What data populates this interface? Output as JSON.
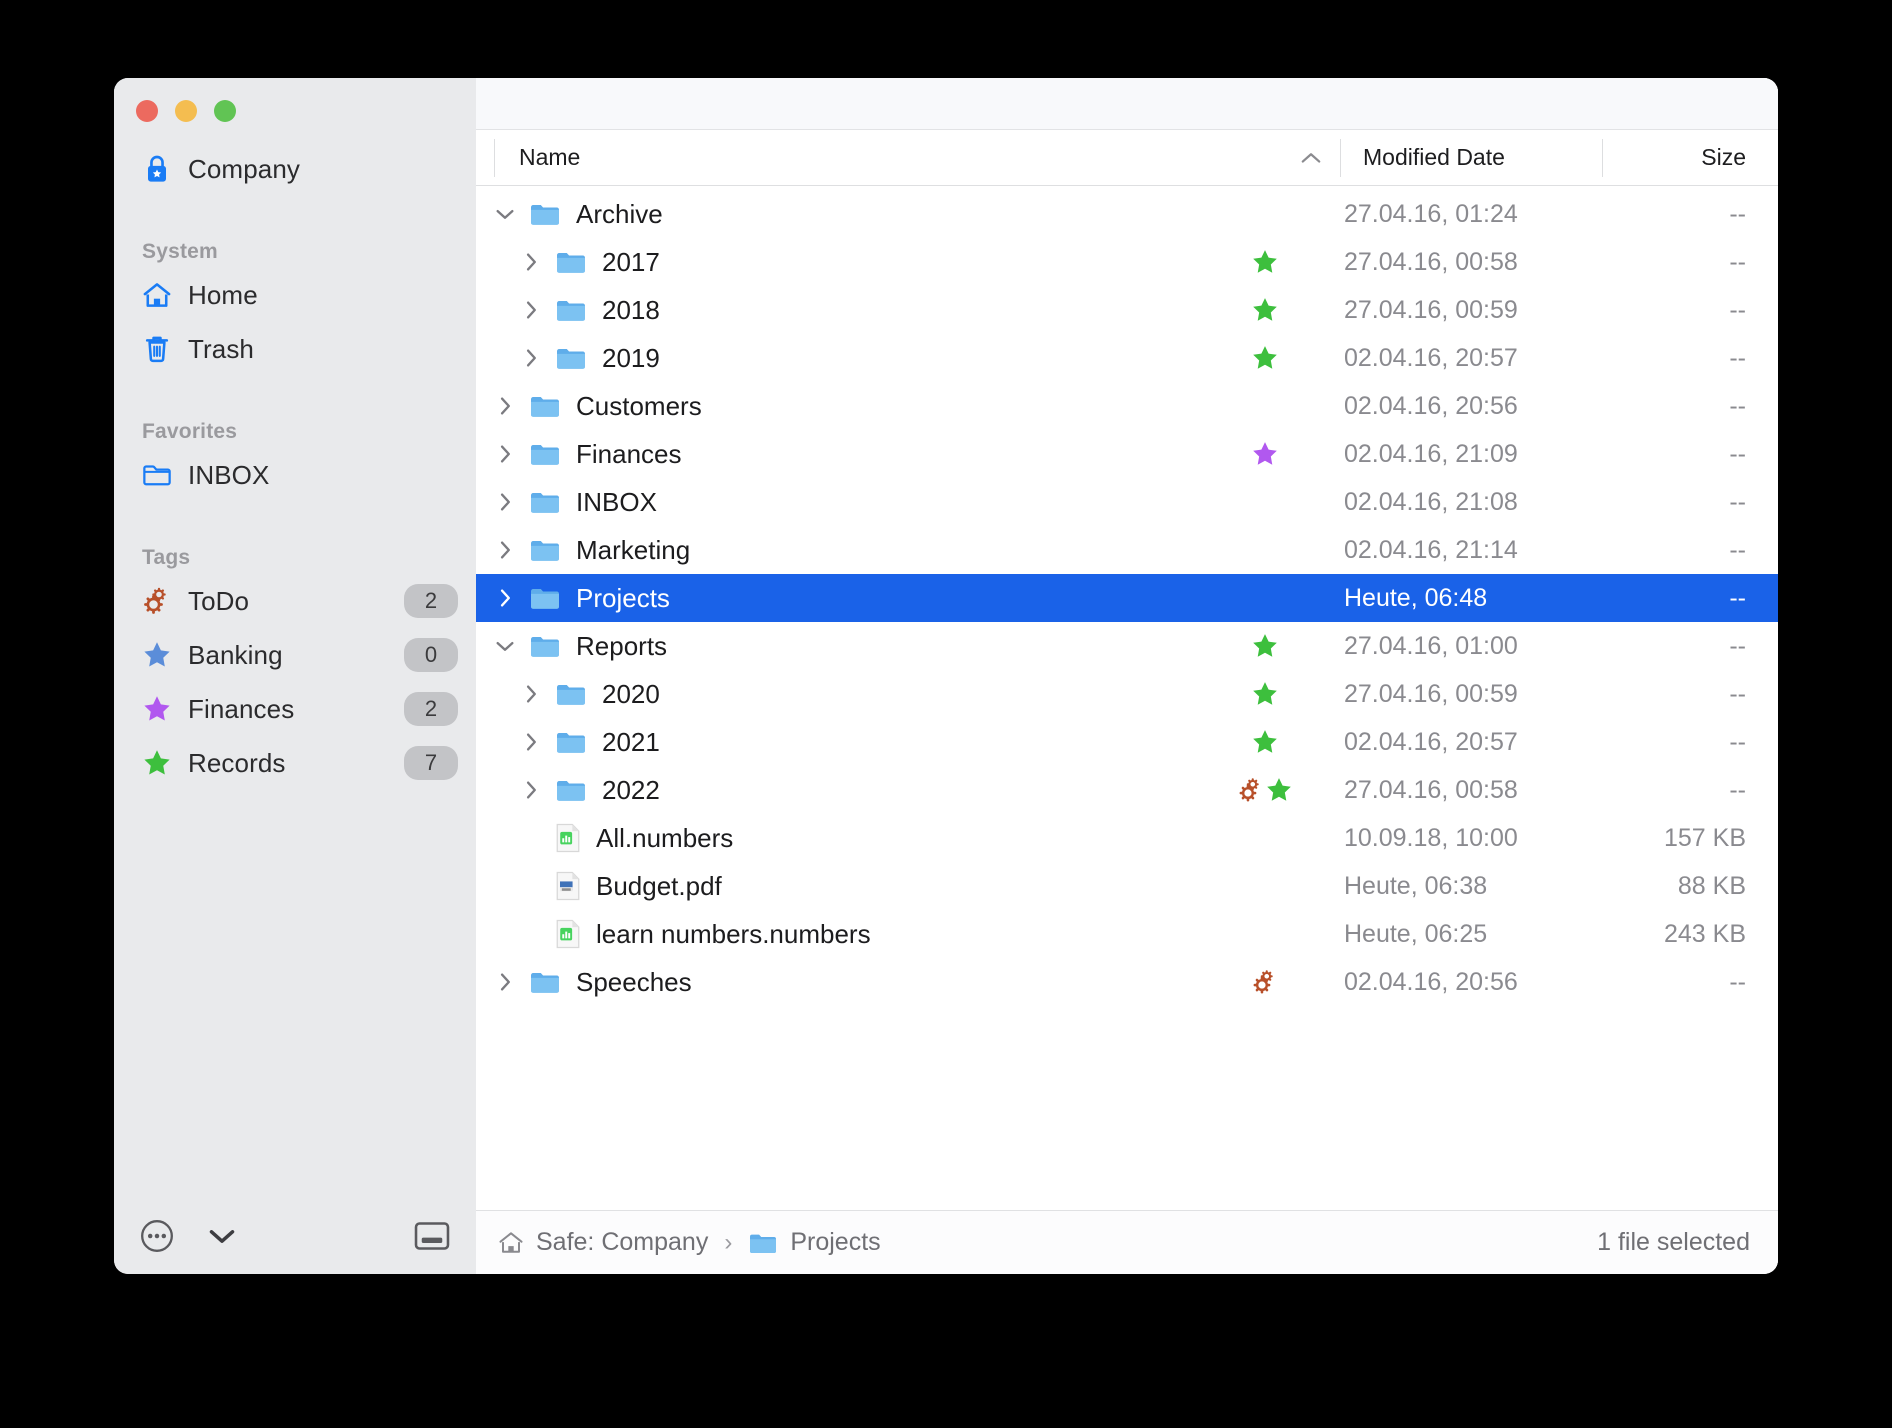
{
  "window": {
    "traffic_lights": [
      "close",
      "minimize",
      "maximize"
    ]
  },
  "sidebar": {
    "vault": {
      "label": "Company",
      "icon": "lock-star-icon"
    },
    "sections": [
      {
        "heading": "System",
        "items": [
          {
            "label": "Home",
            "icon": "home-icon"
          },
          {
            "label": "Trash",
            "icon": "trash-icon"
          }
        ]
      },
      {
        "heading": "Favorites",
        "items": [
          {
            "label": "INBOX",
            "icon": "folder-outline-icon"
          }
        ]
      },
      {
        "heading": "Tags",
        "items": [
          {
            "label": "ToDo",
            "icon": "gears-icon",
            "color": "#b8502a",
            "count": "2"
          },
          {
            "label": "Banking",
            "icon": "star-icon",
            "color": "#5b8dd9",
            "count": "0"
          },
          {
            "label": "Finances",
            "icon": "star-icon",
            "color": "#b158ef",
            "count": "2"
          },
          {
            "label": "Records",
            "icon": "star-icon",
            "color": "#3dbf3d",
            "count": "7"
          }
        ]
      }
    ],
    "toolbar": [
      {
        "name": "more-options-button",
        "icon": "ellipsis-circle-icon"
      },
      {
        "name": "view-options-button",
        "icon": "chevron-down-icon"
      },
      {
        "name": "toggle-preview-button",
        "icon": "panel-bottom-icon"
      }
    ]
  },
  "columns": {
    "name": "Name",
    "modified_date": "Modified Date",
    "size": "Size",
    "sort_caret": "⌃",
    "sorted_by": "name",
    "sort_direction": "ascending"
  },
  "files": [
    {
      "name": "Archive",
      "type": "folder",
      "indent": 0,
      "twisty": "expanded",
      "tags": [],
      "date": "27.04.16, 01:24",
      "size": "--",
      "selected": false
    },
    {
      "name": "2017",
      "type": "folder",
      "indent": 1,
      "twisty": "collapsed",
      "tags": [
        {
          "icon": "star-icon",
          "color": "#3dbf3d"
        }
      ],
      "date": "27.04.16, 00:58",
      "size": "--",
      "selected": false
    },
    {
      "name": "2018",
      "type": "folder",
      "indent": 1,
      "twisty": "collapsed",
      "tags": [
        {
          "icon": "star-icon",
          "color": "#3dbf3d"
        }
      ],
      "date": "27.04.16, 00:59",
      "size": "--",
      "selected": false
    },
    {
      "name": "2019",
      "type": "folder",
      "indent": 1,
      "twisty": "collapsed",
      "tags": [
        {
          "icon": "star-icon",
          "color": "#3dbf3d"
        }
      ],
      "date": "02.04.16, 20:57",
      "size": "--",
      "selected": false
    },
    {
      "name": "Customers",
      "type": "folder",
      "indent": 0,
      "twisty": "collapsed",
      "tags": [],
      "date": "02.04.16, 20:56",
      "size": "--",
      "selected": false
    },
    {
      "name": "Finances",
      "type": "folder",
      "indent": 0,
      "twisty": "collapsed",
      "tags": [
        {
          "icon": "star-icon",
          "color": "#b158ef"
        }
      ],
      "date": "02.04.16, 21:09",
      "size": "--",
      "selected": false
    },
    {
      "name": "INBOX",
      "type": "folder",
      "indent": 0,
      "twisty": "collapsed",
      "tags": [],
      "date": "02.04.16, 21:08",
      "size": "--",
      "selected": false
    },
    {
      "name": "Marketing",
      "type": "folder",
      "indent": 0,
      "twisty": "collapsed",
      "tags": [],
      "date": "02.04.16, 21:14",
      "size": "--",
      "selected": false
    },
    {
      "name": "Projects",
      "type": "folder",
      "indent": 0,
      "twisty": "collapsed",
      "tags": [],
      "date": "Heute, 06:48",
      "size": "--",
      "selected": true
    },
    {
      "name": "Reports",
      "type": "folder",
      "indent": 0,
      "twisty": "expanded",
      "tags": [
        {
          "icon": "star-icon",
          "color": "#3dbf3d"
        }
      ],
      "date": "27.04.16, 01:00",
      "size": "--",
      "selected": false
    },
    {
      "name": "2020",
      "type": "folder",
      "indent": 1,
      "twisty": "collapsed",
      "tags": [
        {
          "icon": "star-icon",
          "color": "#3dbf3d"
        }
      ],
      "date": "27.04.16, 00:59",
      "size": "--",
      "selected": false
    },
    {
      "name": "2021",
      "type": "folder",
      "indent": 1,
      "twisty": "collapsed",
      "tags": [
        {
          "icon": "star-icon",
          "color": "#3dbf3d"
        }
      ],
      "date": "02.04.16, 20:57",
      "size": "--",
      "selected": false
    },
    {
      "name": "2022",
      "type": "folder",
      "indent": 1,
      "twisty": "collapsed",
      "tags": [
        {
          "icon": "gears-icon",
          "color": "#b8502a"
        },
        {
          "icon": "star-icon",
          "color": "#3dbf3d"
        }
      ],
      "date": "27.04.16, 00:58",
      "size": "--",
      "selected": false
    },
    {
      "name": "All.numbers",
      "type": "numbers",
      "indent": 1,
      "twisty": "none",
      "tags": [],
      "date": "10.09.18, 10:00",
      "size": "157 KB",
      "selected": false
    },
    {
      "name": "Budget.pdf",
      "type": "pdf",
      "indent": 1,
      "twisty": "none",
      "tags": [],
      "date": "Heute, 06:38",
      "size": "88 KB",
      "selected": false
    },
    {
      "name": "learn numbers.numbers",
      "type": "numbers",
      "indent": 1,
      "twisty": "none",
      "tags": [],
      "date": "Heute, 06:25",
      "size": "243 KB",
      "selected": false
    },
    {
      "name": "Speeches",
      "type": "folder",
      "indent": 0,
      "twisty": "collapsed",
      "tags": [
        {
          "icon": "gears-icon",
          "color": "#b8502a"
        }
      ],
      "date": "02.04.16, 20:56",
      "size": "--",
      "selected": false
    }
  ],
  "statusbar": {
    "breadcrumb": [
      {
        "label": "Safe: Company",
        "icon": "home-icon"
      },
      {
        "label": "Projects",
        "icon": "folder-icon"
      }
    ],
    "separator": "›",
    "selection_info": "1 file selected"
  },
  "colors": {
    "selection_blue": "#1a62e8",
    "folder_blue": "#6fb7ef",
    "accent_blue": "#1a7cf5",
    "tag_green": "#3dbf3d",
    "tag_purple": "#b158ef",
    "tag_blue": "#5b8dd9",
    "tag_rust": "#b8502a"
  }
}
